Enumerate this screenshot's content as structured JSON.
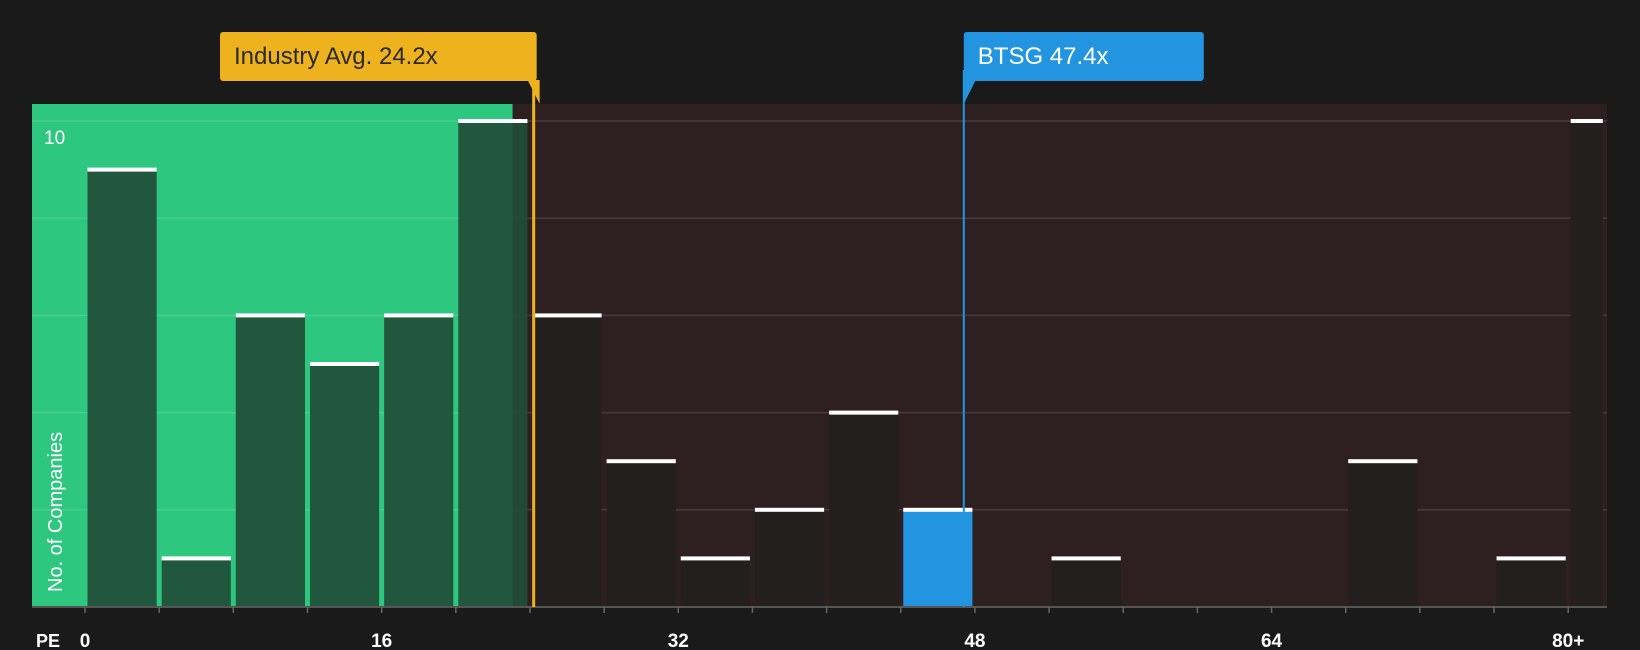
{
  "chart_data": {
    "type": "bar",
    "x_axis_label": "PE",
    "y_axis_label": "No. of Companies",
    "x_tick_labels": [
      "0",
      "16",
      "32",
      "48",
      "64",
      "80+"
    ],
    "x_tick_values": [
      0,
      16,
      32,
      48,
      64,
      80
    ],
    "y_tick_labels": [
      "10"
    ],
    "y_tick_values": [
      10
    ],
    "ylim": [
      0,
      10.35
    ],
    "bin_width": 4,
    "bins": [
      {
        "start": 0,
        "end": 4,
        "value": 9
      },
      {
        "start": 4,
        "end": 8,
        "value": 1
      },
      {
        "start": 8,
        "end": 12,
        "value": 6
      },
      {
        "start": 12,
        "end": 16,
        "value": 5
      },
      {
        "start": 16,
        "end": 20,
        "value": 6
      },
      {
        "start": 20,
        "end": 24,
        "value": 10
      },
      {
        "start": 24,
        "end": 28,
        "value": 6
      },
      {
        "start": 28,
        "end": 32,
        "value": 3
      },
      {
        "start": 32,
        "end": 36,
        "value": 1
      },
      {
        "start": 36,
        "end": 40,
        "value": 2
      },
      {
        "start": 40,
        "end": 44,
        "value": 4
      },
      {
        "start": 44,
        "end": 48,
        "value": 2,
        "highlight": true
      },
      {
        "start": 48,
        "end": 52,
        "value": 0
      },
      {
        "start": 52,
        "end": 56,
        "value": 1
      },
      {
        "start": 56,
        "end": 60,
        "value": 0
      },
      {
        "start": 60,
        "end": 64,
        "value": 0
      },
      {
        "start": 64,
        "end": 68,
        "value": 0
      },
      {
        "start": 68,
        "end": 72,
        "value": 3
      },
      {
        "start": 72,
        "end": 76,
        "value": 0
      },
      {
        "start": 76,
        "end": 80,
        "value": 1
      },
      {
        "start": 80,
        "end": 82,
        "value": 10
      }
    ],
    "industry_avg": {
      "label": "Industry Avg. 24.2x",
      "value": 24.2
    },
    "company": {
      "label": "BTSG 47.4x",
      "value": 47.4
    },
    "grid": true,
    "colors": {
      "background": "#1a1a1a",
      "below_avg_zone": "#2ec780",
      "above_avg_zone": "#2e1f20",
      "bar_in_green_zone": "#214d37",
      "bar_in_red_zone": "#241f1f",
      "highlight_bar": "#2394e0",
      "bar_cap": "#ffffff",
      "industry_avg": "#eeb21e",
      "company": "#2394e0",
      "axis_text": "#ffffff"
    }
  }
}
